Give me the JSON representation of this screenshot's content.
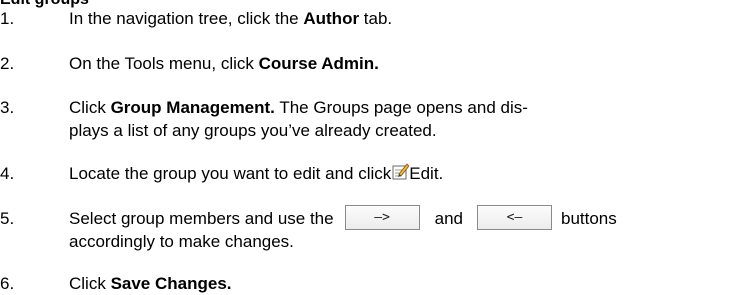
{
  "heading": "Edit groups",
  "steps": [
    {
      "number": "1.",
      "before": "In the navigation tree, click the ",
      "bold": "Author",
      "after": " tab."
    },
    {
      "number": "2.",
      "before": "On the Tools menu, click ",
      "bold": "Course Admin."
    },
    {
      "number": "3.",
      "before": "Click ",
      "bold": "Group Management.",
      "after_line1": " The Groups page opens and dis-",
      "line2": "plays a list of any groups you’ve already created."
    },
    {
      "number": "4.",
      "before": "Locate the group you want to edit and click",
      "icon": "edit-pencil-icon",
      "after": "Edit."
    },
    {
      "number": "5.",
      "before": "Select group members and use the",
      "button_right": "—>",
      "middle": "and",
      "button_left": "<—",
      "after": "buttons",
      "line2": "accordingly to make changes."
    },
    {
      "number": "6.",
      "before": "Click ",
      "bold": "Save Changes."
    }
  ]
}
